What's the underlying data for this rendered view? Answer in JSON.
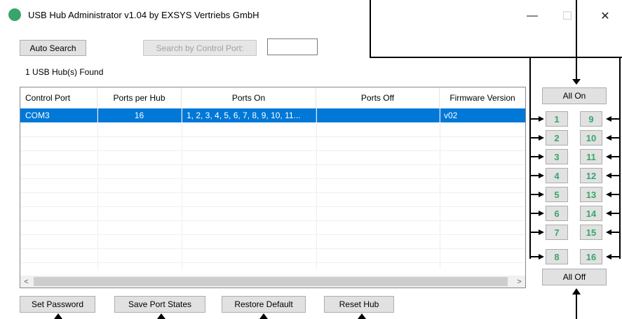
{
  "window": {
    "title": "USB Hub Administrator v1.04 by EXSYS Vertriebs GmbH",
    "icon": "usb-app-icon",
    "minimize_glyph": "—",
    "maximize_glyph": "☐",
    "close_glyph": "✕"
  },
  "toolbar": {
    "auto_search_label": "Auto Search",
    "search_by_port_label": "Search by Control Port:",
    "control_port_value": ""
  },
  "status": {
    "hubs_found": "1 USB Hub(s) Found"
  },
  "table": {
    "columns": [
      "Control Port",
      "Ports per Hub",
      "Ports On",
      "Ports Off",
      "Firmware Version"
    ],
    "rows": [
      [
        "COM3",
        "16",
        "1, 2, 3, 4, 5, 6, 7, 8, 9, 10, 11...",
        "",
        "v02"
      ]
    ],
    "scroll_left": "<",
    "scroll_right": ">"
  },
  "ports": {
    "all_on_label": "All On",
    "all_off_label": "All Off",
    "left_column": [
      "1",
      "2",
      "3",
      "4",
      "5",
      "6",
      "7",
      "8"
    ],
    "right_column": [
      "9",
      "10",
      "11",
      "12",
      "13",
      "14",
      "15",
      "16"
    ],
    "port_label_color": "#3aa56b"
  },
  "footer": {
    "set_password_label": "Set Password",
    "save_port_states_label": "Save Port States",
    "restore_default_label": "Restore Default",
    "reset_hub_label": "Reset Hub"
  },
  "colors": {
    "selection": "#0078d7",
    "button_face": "#e1e1e1",
    "annotation": "#000000"
  }
}
